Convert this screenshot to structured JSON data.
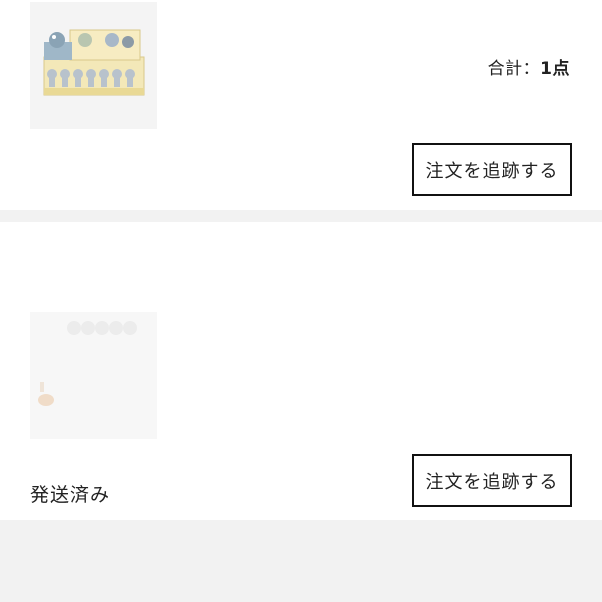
{
  "orders": [
    {
      "thumbnail_icon": "product-box-image",
      "total_label": "合計：",
      "total_count": "1点",
      "track_button_label": "注文を追跡する"
    },
    {
      "status": "発送済み",
      "thumbnail_icon": "product-image",
      "track_button_label": "注文を追跡する"
    }
  ],
  "colors": {
    "background": "#f2f2f2",
    "card": "#ffffff",
    "button_border": "#111111"
  }
}
